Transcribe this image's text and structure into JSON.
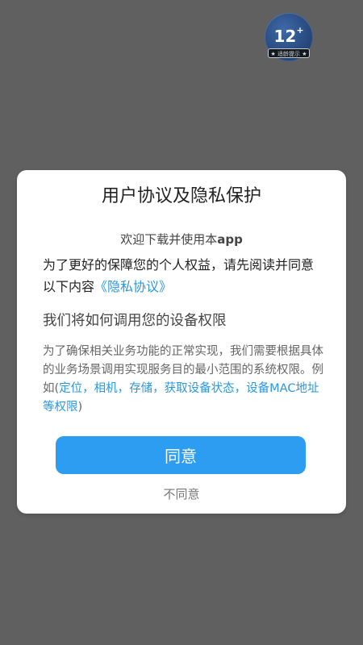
{
  "age_rating": {
    "value": "12",
    "plus": "+",
    "caption": "★ 适龄提示 ★"
  },
  "dialog": {
    "title": "用户协议及隐私保护",
    "welcome_prefix": "欢迎下载并使用本",
    "welcome_app": "app",
    "intro_text": "为了更好的保障您的个人权益，请先阅读并同意以下内容",
    "privacy_link": "《隐私协议》",
    "section_title": "我们将如何调用您的设备权限",
    "permissions_text": "为了确保相关业务功能的正常实现，我们需要根据具体的业务场景调用实现服务目的最小范围的系统权限。例如(",
    "permissions_highlight": "定位，相机，存储，获取设备状态，设备MAC地址等权限",
    "permissions_end": ")",
    "agree_label": "同意",
    "disagree_label": "不同意"
  },
  "colors": {
    "backdrop": "#606060",
    "accent": "#2c9df0",
    "link": "#2a98e0"
  }
}
